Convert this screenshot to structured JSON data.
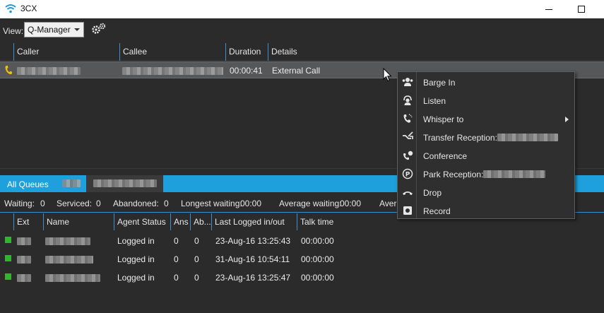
{
  "window": {
    "title": "3CX"
  },
  "toolbar": {
    "view_label": "View:",
    "view_value": "Q-Manager"
  },
  "calls": {
    "columns": [
      "Caller",
      "Callee",
      "Duration",
      "Details"
    ],
    "rows": [
      {
        "duration": "00:00:41",
        "details": "External Call"
      }
    ]
  },
  "context_menu": {
    "items": [
      {
        "label": "Barge In",
        "icon": "barge-in-icon"
      },
      {
        "label": "Listen",
        "icon": "listen-icon"
      },
      {
        "label": "Whisper to",
        "icon": "whisper-icon",
        "has_submenu": true
      },
      {
        "label": "Transfer Reception:",
        "icon": "transfer-icon"
      },
      {
        "label": "Conference",
        "icon": "conference-icon"
      },
      {
        "label": "Park Reception:",
        "icon": "park-icon"
      },
      {
        "label": "Drop",
        "icon": "drop-icon"
      },
      {
        "label": "Record",
        "icon": "record-icon"
      }
    ]
  },
  "queues": {
    "tabs": [
      "All Queues"
    ],
    "stats": {
      "waiting_label": "Waiting:",
      "waiting": "0",
      "serviced_label": "Serviced:",
      "serviced": "0",
      "abandoned_label": "Abandoned:",
      "abandoned": "0",
      "longest_label": "Longest waiting:",
      "longest": "00:00",
      "average_label": "Average waiting:",
      "average": "00:00",
      "truncated_label": "Avera"
    },
    "agent_columns": [
      "Ext",
      "Name",
      "Agent Status",
      "Ans",
      "Ab...",
      "Last Logged in/out",
      "Talk time"
    ],
    "agents": [
      {
        "status": "Logged in",
        "ans": "0",
        "ab": "0",
        "last": "23-Aug-16 13:25:43",
        "talk": "00:00:00"
      },
      {
        "status": "Logged in",
        "ans": "0",
        "ab": "0",
        "last": "31-Aug-16 10:54:11",
        "talk": "00:00:00"
      },
      {
        "status": "Logged in",
        "ans": "0",
        "ab": "0",
        "last": "23-Aug-16 13:25:47",
        "talk": "00:00:00"
      }
    ]
  },
  "colors": {
    "accent": "#1ea0dc",
    "status_green": "#2fb52f",
    "phone_yellow": "#f2c200"
  }
}
